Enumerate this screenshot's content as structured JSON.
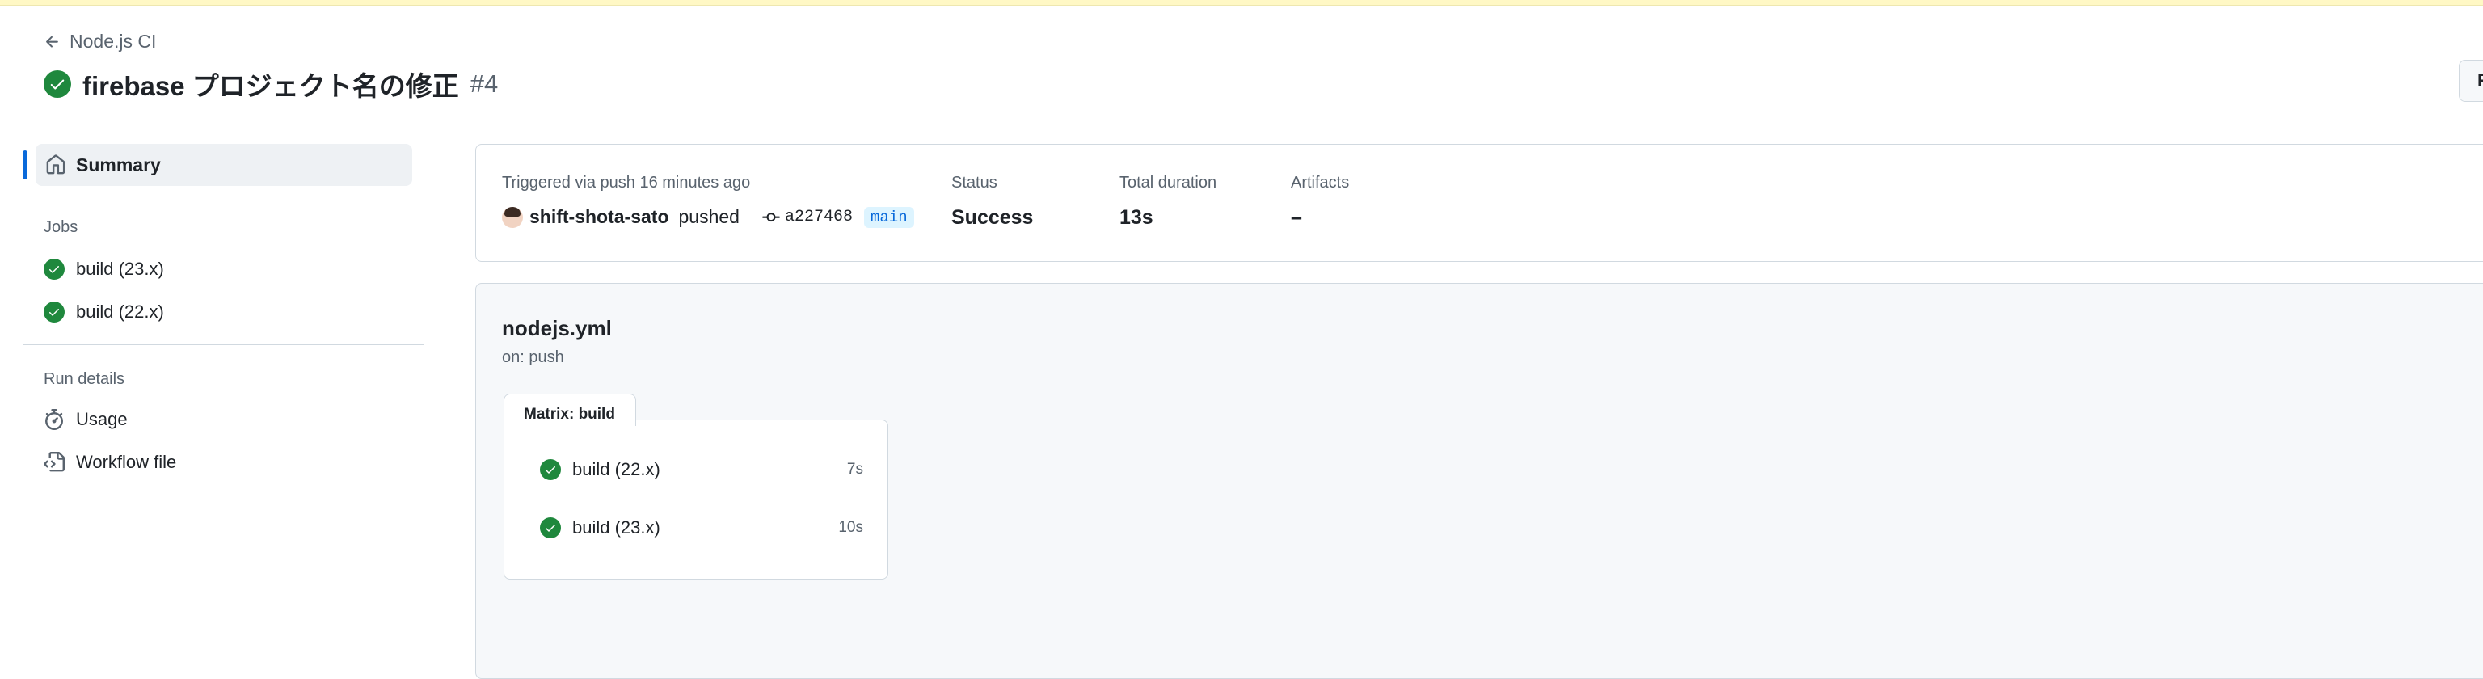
{
  "header": {
    "back_label": "Node.js CI",
    "title": "firebase プロジェクト名の修正",
    "run_number": "#4",
    "right_button_label": "R"
  },
  "sidebar": {
    "summary_label": "Summary",
    "jobs_heading": "Jobs",
    "jobs": [
      {
        "label": "build (23.x)"
      },
      {
        "label": "build (22.x)"
      }
    ],
    "run_details_heading": "Run details",
    "usage_label": "Usage",
    "workflow_file_label": "Workflow file"
  },
  "summary": {
    "triggered_label": "Triggered via push 16 minutes ago",
    "actor": "shift-shota-sato",
    "action": "pushed",
    "commit": "a227468",
    "branch": "main",
    "status_label": "Status",
    "status_value": "Success",
    "duration_label": "Total duration",
    "duration_value": "13s",
    "artifacts_label": "Artifacts",
    "artifacts_value": "–"
  },
  "workflow": {
    "name": "nodejs.yml",
    "trigger": "on: push",
    "matrix_label": "Matrix: build",
    "jobs": [
      {
        "label": "build (22.x)",
        "duration": "7s"
      },
      {
        "label": "build (23.x)",
        "duration": "10s"
      }
    ]
  },
  "colors": {
    "success": "#1f883d",
    "accent": "#0969da",
    "warning_bar": "#fff8c5"
  }
}
